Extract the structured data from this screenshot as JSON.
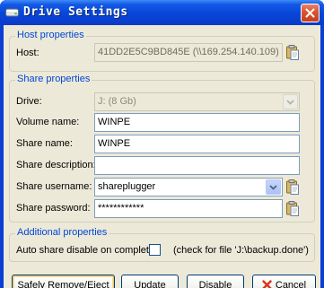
{
  "window": {
    "title": "Drive Settings",
    "icons": {
      "app": "drive-icon",
      "close": "close-icon"
    }
  },
  "host_group": {
    "label": "Host properties",
    "host_label": "Host:",
    "host_value": "41DD2E5C9BD845E (\\\\169.254.140.109)"
  },
  "share_group": {
    "label": "Share properties",
    "drive_label": "Drive:",
    "drive_value": "J:  (8 Gb)",
    "volume_name_label": "Volume name:",
    "volume_name_value": "WINPE",
    "share_name_label": "Share name:",
    "share_name_value": "WINPE",
    "share_description_label": "Share description:",
    "share_description_value": "",
    "share_username_label": "Share username:",
    "share_username_value": "shareplugger",
    "share_password_label": "Share password:",
    "share_password_value": "************"
  },
  "additional_group": {
    "label": "Additional properties",
    "auto_disable_label": "Auto share disable on complete",
    "auto_disable_checked": false,
    "check_file_text": "(check for file 'J:\\backup.done')"
  },
  "buttons": {
    "safely_remove": "Safely Remove/Eject",
    "update": "Update",
    "disable": "Disable",
    "cancel": "Cancel"
  },
  "colors": {
    "titlebar": "#0848d8",
    "group_label": "#0046d5",
    "dialog_bg": "#ece9d8",
    "cancel_icon": "#d8341d"
  }
}
